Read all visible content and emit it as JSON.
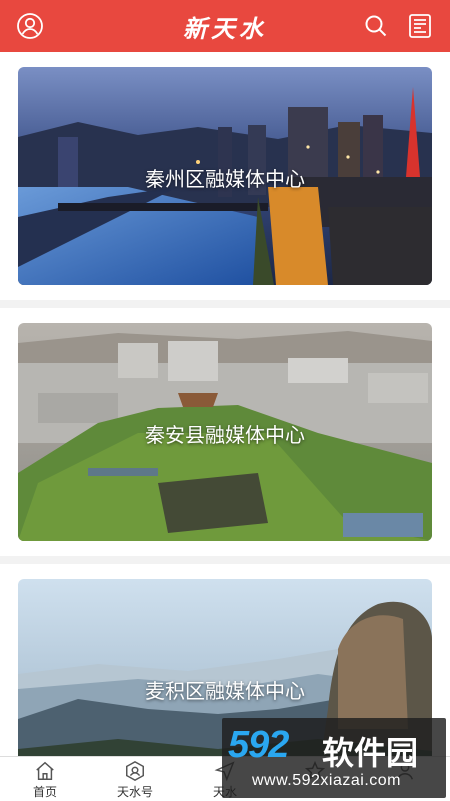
{
  "header": {
    "title": "新天水",
    "icons": [
      "user-icon",
      "search-icon",
      "newspaper-icon"
    ]
  },
  "cards": [
    {
      "label": "秦州区融媒体中心"
    },
    {
      "label": "秦安县融媒体中心"
    },
    {
      "label": "麦积区融媒体中心"
    }
  ],
  "tabbar": {
    "tabs": [
      {
        "label": "首页",
        "icon": "home-icon"
      },
      {
        "label": "天水号",
        "icon": "badge-icon"
      },
      {
        "label": "天水",
        "icon": "send-icon"
      },
      {
        "label": "",
        "icon": "star-icon"
      },
      {
        "label": "",
        "icon": "user-icon"
      }
    ]
  },
  "watermark": {
    "brand": "592",
    "name": "软件园",
    "url": "www.592xiazai.com"
  },
  "colors": {
    "brand_red": "#e8483f"
  }
}
